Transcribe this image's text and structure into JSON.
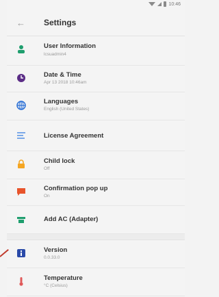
{
  "statusbar": {
    "time": "10:46"
  },
  "toolbar": {
    "title": "Settings"
  },
  "items": [
    {
      "label": "User Information",
      "sub": "lcsuadmin4",
      "icon": "person-icon",
      "color": "#1f9e6e"
    },
    {
      "label": "Date & Time",
      "sub": "Apr 13 2018  10:46am",
      "icon": "clock-icon",
      "color": "#5b2d86"
    },
    {
      "label": "Languages",
      "sub": "English (United States)",
      "icon": "globe-icon",
      "color": "#2a6fd6"
    },
    {
      "label": "License Agreement",
      "sub": "",
      "icon": "document-icon",
      "color": "#7aa8e8"
    },
    {
      "label": "Child lock",
      "sub": "Off",
      "icon": "lock-icon",
      "color": "#f5a623"
    },
    {
      "label": "Confirmation pop up",
      "sub": "On",
      "icon": "message-icon",
      "color": "#e8542b"
    },
    {
      "label": "Add AC (Adapter)",
      "sub": "",
      "icon": "adapter-icon",
      "color": "#1f9e6e"
    }
  ],
  "items2": [
    {
      "label": "Version",
      "sub": "0.0.33.0",
      "icon": "info-icon",
      "color": "#2a4aa8"
    },
    {
      "label": "Temperature",
      "sub": "°C (Celsius)",
      "icon": "thermometer-icon",
      "color": "#e05a5a"
    }
  ]
}
